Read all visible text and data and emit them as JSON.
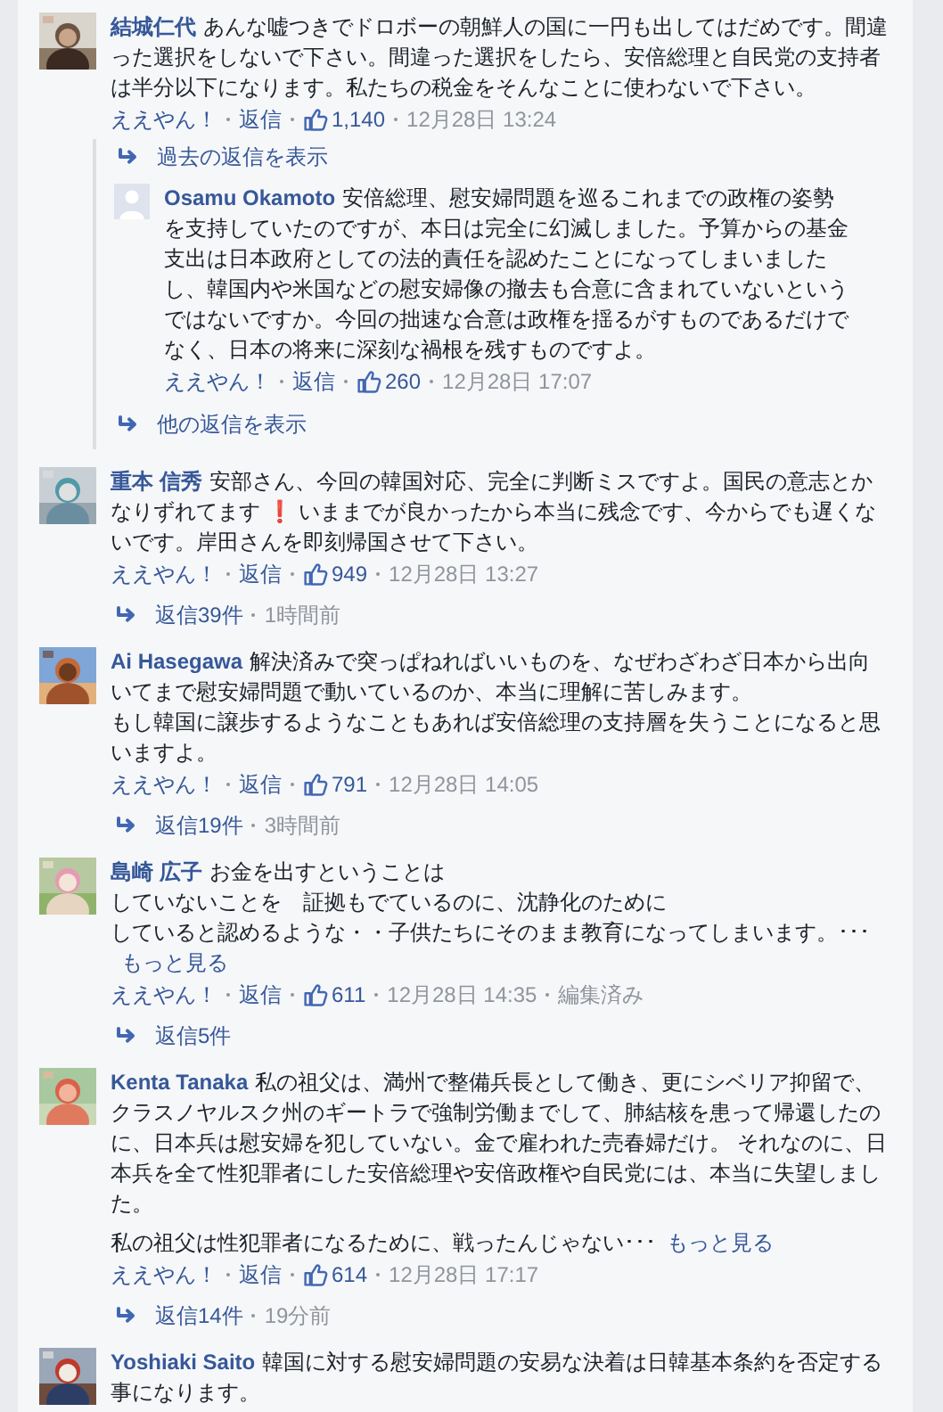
{
  "comments": [
    {
      "avatar": {
        "kind": "picture"
      },
      "name": "結城仁代",
      "paragraphs": [
        [
          "あんな嘘つきでドロボーの朝鮮人の国に一円も出してはだめです。間違った選択をしないで下さい。間違った選択をしたら、安倍総理と自民党の支持者は半分以下になります。私たちの税金をそんなことに使わないで下さい。"
        ]
      ],
      "actions": {
        "like_label": "ええやん！",
        "reply_label": "返信",
        "likes": "1,140",
        "date": "12月28日 13:24"
      },
      "thread": {
        "previous_label": "過去の返信を表示",
        "replies": [
          {
            "avatar": {
              "kind": "silhouette"
            },
            "name": "Osamu Okamoto",
            "paragraphs": [
              [
                "安倍総理、慰安婦問題を巡るこれまでの政権の姿勢を支持していたのですが、本日は完全に幻滅しました。予算からの基金支出は日本政府としての法的責任を認めたことになってしまいましたし、韓国内や米国などの慰安婦像の撤去も合意に含まれていないというではないですか。今回の拙速な合意は政権を揺るがすものであるだけでなく、日本の将来に深刻な禍根を残すものですよ。"
              ]
            ],
            "actions": {
              "like_label": "ええやん！",
              "reply_label": "返信",
              "likes": "260",
              "date": "12月28日 17:07"
            }
          }
        ],
        "more_label": "他の返信を表示"
      }
    },
    {
      "avatar": {
        "kind": "picture"
      },
      "name": "重本 信秀",
      "paragraphs": [
        [
          "安部さん、今回の韓国対応、完全に判断ミスですよ。国民の意志とかなりずれてます ❗ いままでが良かったから本当に残念です、今からでも遅くないです。岸田さんを即刻帰国させて下さい。"
        ]
      ],
      "actions": {
        "like_label": "ええやん！",
        "reply_label": "返信",
        "likes": "949",
        "date": "12月28日 13:27"
      },
      "replies_link": {
        "label": "返信39件",
        "time": "1時間前"
      }
    },
    {
      "avatar": {
        "kind": "picture"
      },
      "name": "Ai Hasegawa",
      "paragraphs": [
        [
          "解決済みで突っぱねればいいものを、なぜわざわざ日本から出向いてまで慰安婦問題で動いているのか、本当に理解に苦しみます。",
          "もし韓国に譲歩するようなこともあれば安倍総理の支持層を失うことになると思いますよ。"
        ]
      ],
      "actions": {
        "like_label": "ええやん！",
        "reply_label": "返信",
        "likes": "791",
        "date": "12月28日 14:05"
      },
      "replies_link": {
        "label": "返信19件",
        "time": "3時間前"
      }
    },
    {
      "avatar": {
        "kind": "picture"
      },
      "name": "島崎 広子",
      "paragraphs": [
        [
          "お金を出すということは",
          "していないことを　証拠もでているのに、沈静化のために",
          "していると認めるような・・子供たちにそのまま教育になってしまいます。･･･"
        ]
      ],
      "more": {
        "label": "もっと見る"
      },
      "actions": {
        "like_label": "ええやん！",
        "reply_label": "返信",
        "likes": "611",
        "date": "12月28日 14:35",
        "edited": "編集済み"
      },
      "replies_link": {
        "label": "返信5件"
      }
    },
    {
      "avatar": {
        "kind": "picture"
      },
      "name": "Kenta Tanaka",
      "paragraphs": [
        [
          "私の祖父は、満州で整備兵長として働き、更にシベリア抑留で、クラスノヤルスク州のギートラで強制労働までして、肺結核を患って帰還したのに、日本兵は慰安婦を犯していない。金で雇われた売春婦だけ。 それなのに、日本兵を全て性犯罪者にした安倍総理や安倍政権や自民党には、本当に失望しました。"
        ],
        [
          "私の祖父は性犯罪者になるために、戦ったんじゃない･･･"
        ]
      ],
      "more": {
        "label": "もっと見る"
      },
      "actions": {
        "like_label": "ええやん！",
        "reply_label": "返信",
        "likes": "614",
        "date": "12月28日 17:17"
      },
      "replies_link": {
        "label": "返信14件",
        "time": "19分前"
      }
    },
    {
      "avatar": {
        "kind": "picture"
      },
      "name": "Yoshiaki Saito",
      "paragraphs": [
        [
          "韓国に対する慰安婦問題の安易な決着は日韓基本条約を否定する事になります。"
        ]
      ]
    }
  ]
}
